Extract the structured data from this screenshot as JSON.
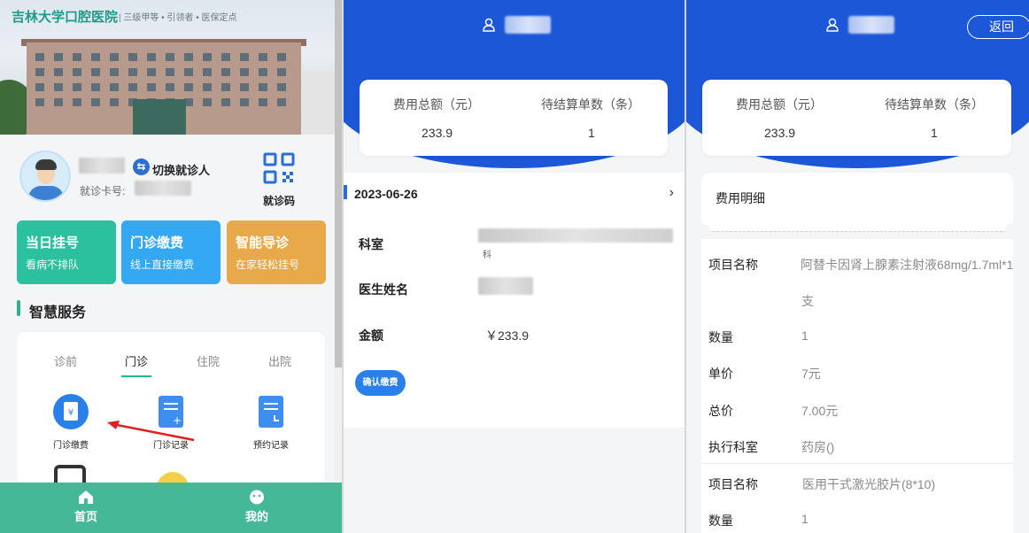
{
  "home": {
    "hospital_name": "吉林大学口腔医院",
    "hospital_tagline": "| 三级甲等 • 引领者 • 医保定点",
    "switch_patient": "切换就诊人",
    "card_no_label": "就诊卡号:",
    "qr_label": "就诊码",
    "tiles": [
      {
        "title": "当日挂号",
        "sub": "看病不排队",
        "color": "#2cc19e"
      },
      {
        "title": "门诊缴费",
        "sub": "线上直接缴费",
        "color": "#35a8f3"
      },
      {
        "title": "智能导诊",
        "sub": "在家轻松挂号",
        "color": "#e8a94a"
      }
    ],
    "section_title": "智慧服务",
    "tabs": [
      "诊前",
      "门诊",
      "住院",
      "出院"
    ],
    "active_tab": "门诊",
    "services": [
      "门诊缴费",
      "门诊记录",
      "预约记录"
    ],
    "bottom_nav": [
      "首页",
      "我的"
    ]
  },
  "list": {
    "summary": {
      "total_label": "费用总额（元）",
      "total_value": "233.9",
      "count_label": "待结算单数（条）",
      "count_value": "1"
    },
    "date": "2023-06-26",
    "dept_label": "科室",
    "dept_tail": "科",
    "doctor_label": "医生姓名",
    "amount_label": "金额",
    "amount_value": "￥233.9",
    "confirm_pay": "确认缴费"
  },
  "detail": {
    "back": "返回",
    "summary": {
      "total_label": "费用总额（元）",
      "total_value": "233.9",
      "count_label": "待结算单数（条）",
      "count_value": "1"
    },
    "detail_title": "费用明细",
    "labels": {
      "item": "项目名称",
      "qty": "数量",
      "unit": "单价",
      "total": "总价",
      "dept": "执行科室"
    },
    "items": [
      {
        "name_line1": "阿替卡因肾上腺素注射液68mg/1.7ml*1",
        "name_line2": "支",
        "qty": "1",
        "unit": "7元",
        "total": "7.00元",
        "dept": "药房()"
      },
      {
        "name_line1": "医用干式激光胶片(8*10)",
        "qty": "1"
      }
    ]
  },
  "colors": {
    "brand_green": "#45b897",
    "header_blue": "#1b57d7",
    "button_blue": "#2b7fe8"
  }
}
